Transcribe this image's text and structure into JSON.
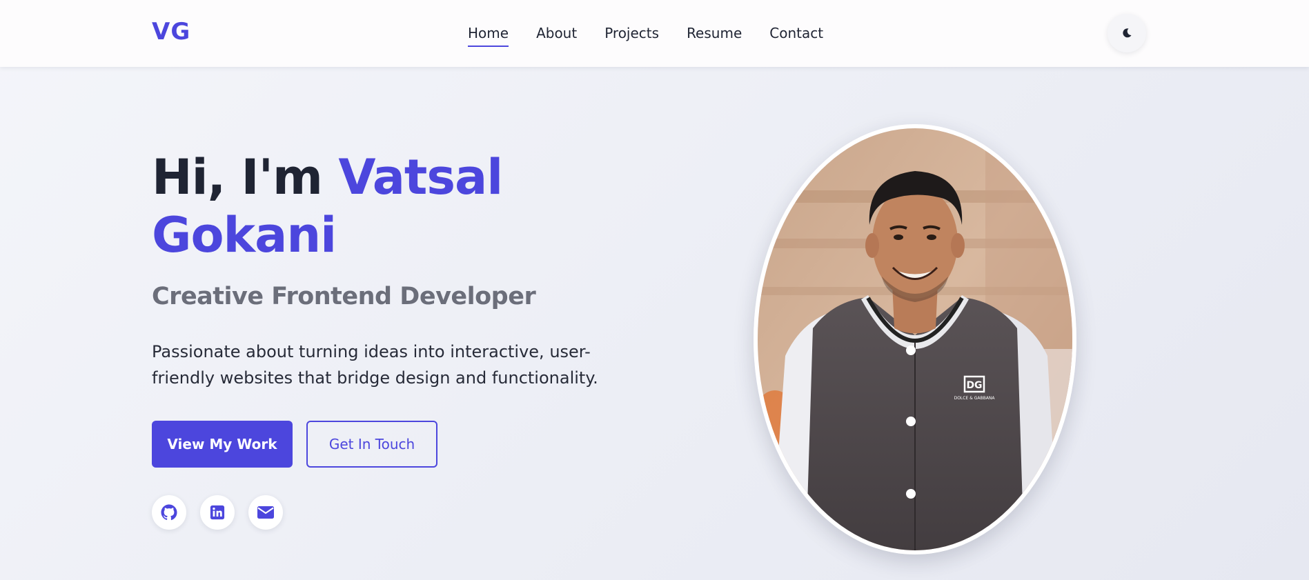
{
  "header": {
    "logo": "VG",
    "nav": [
      {
        "label": "Home",
        "active": true
      },
      {
        "label": "About"
      },
      {
        "label": "Projects"
      },
      {
        "label": "Resume"
      },
      {
        "label": "Contact"
      }
    ],
    "theme_toggle_icon": "moon-icon"
  },
  "hero": {
    "greeting": "Hi, I'm",
    "name_first": "Vatsal",
    "name_last": "Gokani",
    "subtitle": "Creative Frontend Developer",
    "description": "Passionate about turning ideas into interactive, user-friendly websites that bridge design and functionality.",
    "primary_button": "View My Work",
    "secondary_button": "Get In Touch",
    "socials": [
      {
        "icon": "github-icon"
      },
      {
        "icon": "linkedin-icon"
      },
      {
        "icon": "email-icon"
      }
    ],
    "portrait_logo_text": "DOLCE & GABBANA"
  },
  "colors": {
    "accent": "#4c46dd",
    "text_dark": "#1f2433",
    "subtitle_gray": "#6b6e7a"
  }
}
